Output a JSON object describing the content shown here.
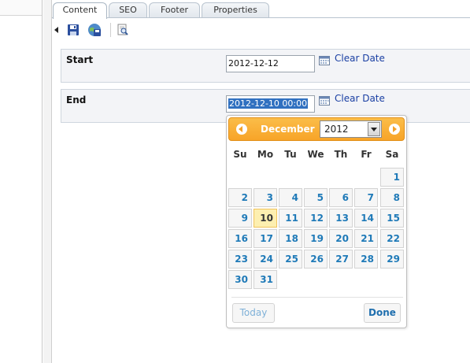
{
  "tabs": [
    {
      "label": "Content",
      "active": true
    },
    {
      "label": "SEO",
      "active": false
    },
    {
      "label": "Footer",
      "active": false
    },
    {
      "label": "Properties",
      "active": false
    }
  ],
  "toolbar": {
    "icons": [
      "collapse-arrow-icon",
      "save-icon",
      "save-and-publish-icon",
      "preview-icon"
    ]
  },
  "fields": {
    "start": {
      "label": "Start",
      "value": "2012-12-12",
      "clear_label": "Clear Date"
    },
    "end": {
      "label": "End",
      "value": "2012-12-10 00:00",
      "clear_label": "Clear Date"
    }
  },
  "datepicker": {
    "month": "December",
    "year": "2012",
    "weekdays": [
      "Su",
      "Mo",
      "Tu",
      "We",
      "Th",
      "Fr",
      "Sa"
    ],
    "weeks": [
      [
        "",
        "",
        "",
        "",
        "",
        "",
        "1"
      ],
      [
        "2",
        "3",
        "4",
        "5",
        "6",
        "7",
        "8"
      ],
      [
        "9",
        "10",
        "11",
        "12",
        "13",
        "14",
        "15"
      ],
      [
        "16",
        "17",
        "18",
        "19",
        "20",
        "21",
        "22"
      ],
      [
        "23",
        "24",
        "25",
        "26",
        "27",
        "28",
        "29"
      ],
      [
        "30",
        "31",
        "",
        "",
        "",
        "",
        ""
      ]
    ],
    "highlighted_day": "10",
    "today_label": "Today",
    "done_label": "Done"
  },
  "colors": {
    "header_orange": "#f7a428",
    "day_link_blue": "#1f7ab8",
    "highlight_yellow": "#fdefb0",
    "selection_blue": "#3070c0",
    "link_blue": "#1a3fa3"
  }
}
